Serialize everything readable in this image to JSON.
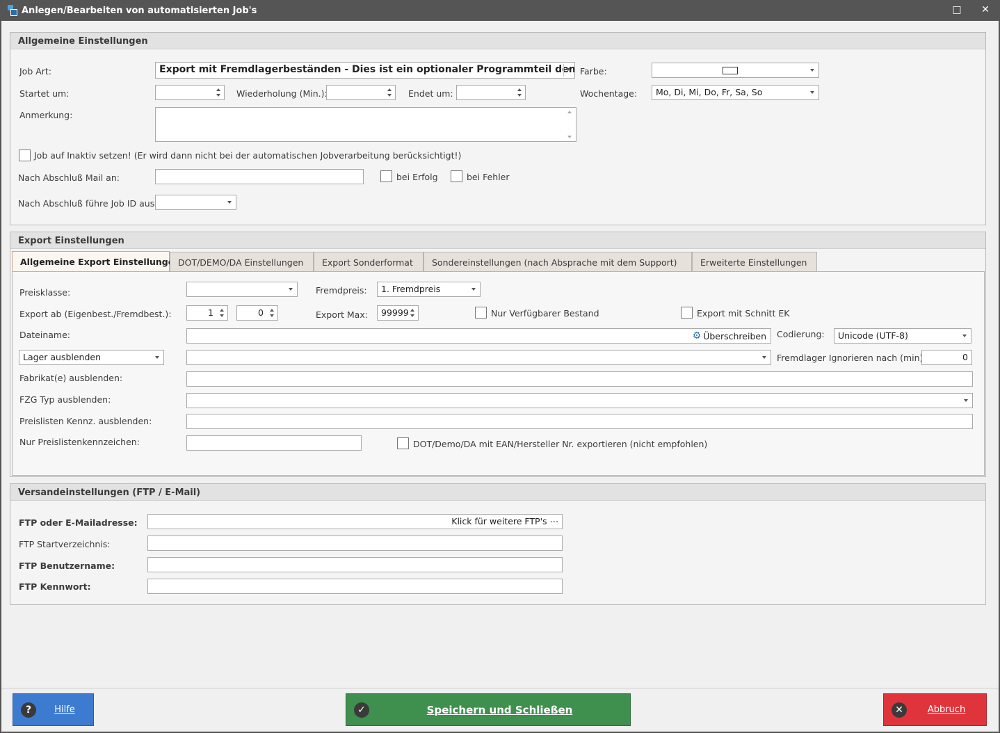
{
  "window": {
    "title": "Anlegen/Bearbeiten von automatisierten Job's",
    "maximize_glyph": "□",
    "close_glyph": "✕"
  },
  "allgemein": {
    "header": "Allgemeine Einstellungen",
    "job_art_label": "Job Art:",
    "job_art_value": "Export mit Fremdlagerbeständen - Dies ist ein optionaler Programmteil den...",
    "farbe_label": "Farbe:",
    "startet_label": "Startet um:",
    "startet_value": "",
    "wiederholung_label": "Wiederholung (Min.):",
    "wiederholung_value": "",
    "endet_label": "Endet um:",
    "endet_value": "",
    "wochentage_label": "Wochentage:",
    "wochentage_value": "Mo, Di, Mi, Do, Fr, Sa, So",
    "anmerkung_label": "Anmerkung:",
    "anmerkung_value": "",
    "inaktiv_label": "Job auf Inaktiv setzen! (Er wird dann nicht bei der automatischen Jobverarbeitung berücksichtigt!)",
    "mail_label": "Nach Abschluß Mail an:",
    "mail_value": "",
    "bei_erfolg_label": "bei Erfolg",
    "bei_fehler_label": "bei Fehler",
    "job_id_label": "Nach Abschluß führe Job ID aus:",
    "job_id_value": ""
  },
  "export": {
    "header": "Export Einstellungen",
    "tabs": [
      {
        "label": "Allgemeine Export Einstellungen",
        "active": true
      },
      {
        "label": "DOT/DEMO/DA Einstellungen",
        "active": false
      },
      {
        "label": "Export Sonderformat",
        "active": false
      },
      {
        "label": "Sondereinstellungen (nach Absprache mit dem Support)",
        "active": false
      },
      {
        "label": "Erweiterte Einstellungen",
        "active": false
      }
    ],
    "preisklasse_label": "Preisklasse:",
    "preisklasse_value": "",
    "fremdpreis_label": "Fremdpreis:",
    "fremdpreis_value": "1. Fremdpreis",
    "export_ab_label": "Export ab (Eigenbest./Fremdbest.):",
    "export_ab_eigen": "1",
    "export_ab_fremd": "0",
    "export_max_label": "Export Max:",
    "export_max_value": "99999",
    "nur_verfuegbar_label": "Nur Verfügbarer Bestand",
    "schnitt_ek_label": "Export mit Schnitt EK",
    "dateiname_label": "Dateiname:",
    "dateiname_value": "",
    "ueberschreiben_label": "Überschreiben",
    "codierung_label": "Codierung:",
    "codierung_value": "Unicode (UTF-8)",
    "lager_select": "Lager ausblenden",
    "lager_value": "",
    "fremdlager_label": "Fremdlager Ignorieren nach (min):",
    "fremdlager_value": "0",
    "fabrikat_label": "Fabrikat(e) ausblenden:",
    "fabrikat_value": "",
    "fzg_label": "FZG Typ  ausblenden:",
    "fzg_value": "",
    "preislisten_kennz_label": "Preislisten Kennz. ausblenden:",
    "preislisten_kennz_value": "",
    "nur_preislisten_label": "Nur Preislistenkennzeichen:",
    "nur_preislisten_value": "",
    "dot_ean_label": "DOT/Demo/DA mit EAN/Hersteller Nr. exportieren (nicht empfohlen)"
  },
  "versand": {
    "header": "Versandeinstellungen (FTP / E-Mail)",
    "ftp_label": "FTP oder E-Mailadresse:",
    "ftp_hint": "Klick für weitere FTP's ⋯",
    "start_label": "FTP Startverzeichnis:",
    "start_value": "",
    "user_label": "FTP Benutzername:",
    "user_value": "",
    "pass_label": "FTP Kennwort:",
    "pass_value": ""
  },
  "buttons": {
    "hilfe": "Hilfe",
    "hilfe_icon": "?",
    "speichern": "Speichern und Schließen",
    "speichern_icon": "✓",
    "abbruch": "Abbruch",
    "abbruch_icon": "✕"
  },
  "colors": {
    "hilfe_bg": "#3d7bd0",
    "speichern_bg": "#3f8f4e",
    "abbruch_bg": "#e0343d",
    "titlebar_bg": "#555555",
    "gear_icon": "#2f6fb3"
  }
}
